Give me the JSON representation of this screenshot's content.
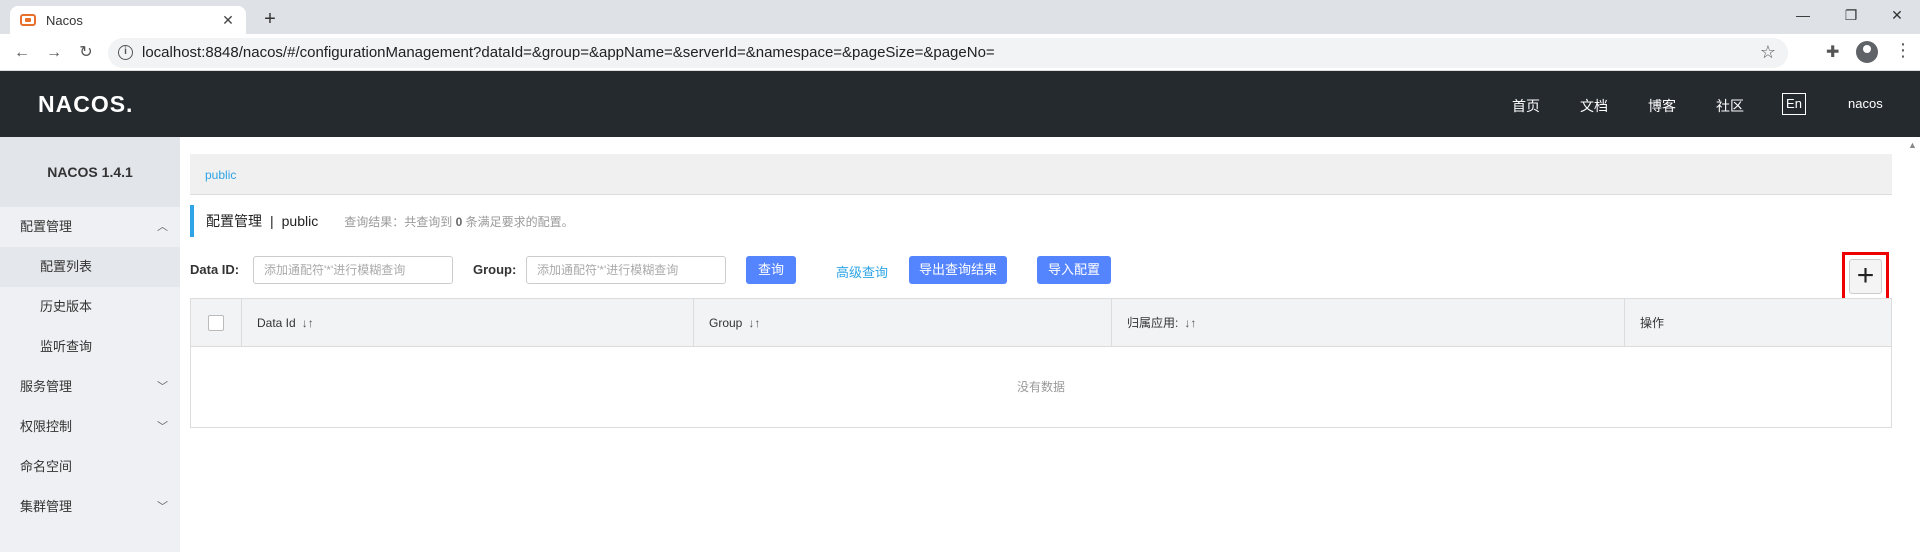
{
  "browser": {
    "tab_title": "Nacos",
    "tab_close": "✕",
    "new_tab": "+",
    "url": "localhost:8848/nacos/#/configurationManagement?dataId=&group=&appName=&serverId=&namespace=&pageSize=&pageNo=",
    "window_controls": {
      "minimize": "—",
      "restore": "❐",
      "close": "✕"
    }
  },
  "header": {
    "logo": "NACOS.",
    "nav": [
      "首页",
      "文档",
      "博客",
      "社区"
    ],
    "lang": "En",
    "user": "nacos"
  },
  "sidebar": {
    "version": "NACOS 1.4.1",
    "items": [
      {
        "label": "配置管理",
        "chevron": "^"
      },
      {
        "label": "配置列表"
      },
      {
        "label": "历史版本"
      },
      {
        "label": "监听查询"
      },
      {
        "label": "服务管理",
        "chevron": "v"
      },
      {
        "label": "权限控制",
        "chevron": "v"
      },
      {
        "label": "命名空间"
      },
      {
        "label": "集群管理",
        "chevron": "v"
      }
    ]
  },
  "main": {
    "namespace_tab": "public",
    "page_title": "配置管理",
    "separator": "|",
    "namespace": "public",
    "result_prefix": "查询结果：共查询到",
    "result_count": "0",
    "result_suffix": "条满足要求的配置。",
    "filters": {
      "dataid_label": "Data ID:",
      "dataid_placeholder": "添加通配符'*'进行模糊查询",
      "group_label": "Group:",
      "group_placeholder": "添加通配符'*'进行模糊查询"
    },
    "buttons": {
      "query": "查询",
      "advanced": "高级查询",
      "export": "导出查询结果",
      "import": "导入配置",
      "add": "+"
    },
    "table": {
      "columns": [
        "Data Id",
        "Group",
        "归属应用:",
        "操作"
      ],
      "sort_icon": "↓↑",
      "empty_text": "没有数据"
    }
  }
}
